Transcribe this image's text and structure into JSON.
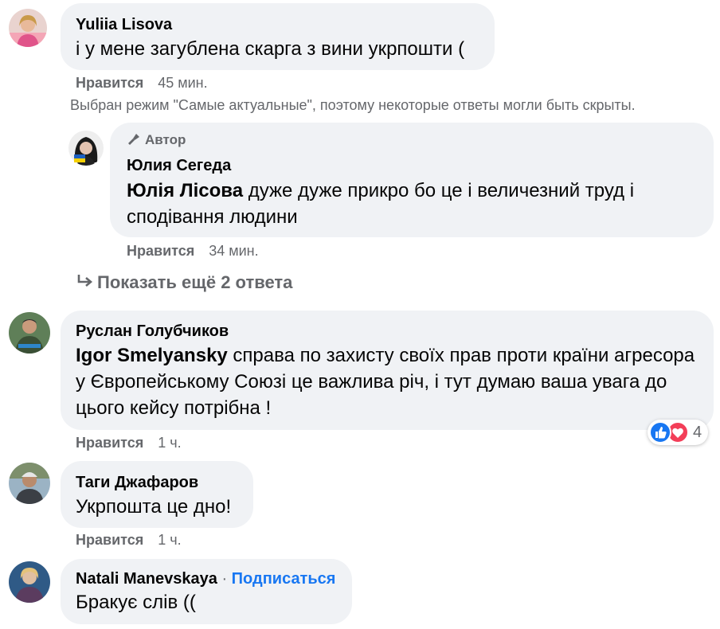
{
  "comments": [
    {
      "author": "Yuliia Lisova",
      "text": "і у мене загублена скарга з вини укрпошти (",
      "like": "Нравится",
      "time": "45 мин."
    },
    {
      "badge": "Автор",
      "author": "Юлия Сегеда",
      "tag": "Юлія Лісова",
      "text": " дуже дуже прикро бо це і величезний труд і сподівання людини",
      "like": "Нравится",
      "time": "34 мин."
    },
    {
      "author": "Руслан Голубчиков",
      "tag": "Igor Smelyansky",
      "text": " справа по захисту своїх прав проти країни агресора у Європейському Союзі це важлива річ, і тут думаю ваша увага до цього кейсу потрібна !",
      "like": "Нравится",
      "time": "1 ч.",
      "reactions": {
        "count": "4",
        "types": [
          "like-icon",
          "love-icon"
        ]
      }
    },
    {
      "author": "Таги Джафаров",
      "text": "Укрпошта це дно!",
      "like": "Нравится",
      "time": "1 ч."
    },
    {
      "author": "Natali Manevskaya",
      "separator": " · ",
      "follow": "Подписаться",
      "text": "Бракує слів (("
    }
  ],
  "notice": "Выбран режим \"Самые актуальные\", поэтому некоторые ответы могли быть скрыты.",
  "show_more": "Показать ещё 2 ответа",
  "colors": {
    "bubble": "#f0f2f5",
    "secondary_text": "#65676b",
    "link": "#1877f2",
    "like_blue": "#1877f2",
    "love_red": "#f33e58"
  }
}
